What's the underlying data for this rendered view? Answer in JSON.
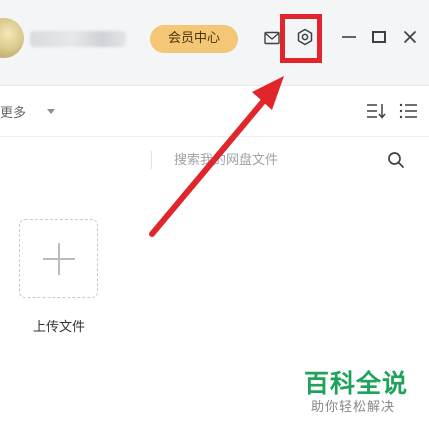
{
  "header": {
    "vip_button": "会员中心",
    "icons": {
      "mail": "mail-icon",
      "settings": "gear-icon",
      "minimize": "minimize-icon",
      "maximize": "maximize-icon",
      "close": "close-icon"
    }
  },
  "toolbar": {
    "more_label": "更多"
  },
  "search": {
    "placeholder": "搜索我的网盘文件"
  },
  "upload": {
    "label": "上传文件"
  },
  "watermark": {
    "title": "百科全说",
    "subtitle": "助你轻松解决"
  },
  "colors": {
    "vip_bg": "#f3c775",
    "highlight": "#e0262b",
    "watermark_green": "#1fa35a"
  }
}
